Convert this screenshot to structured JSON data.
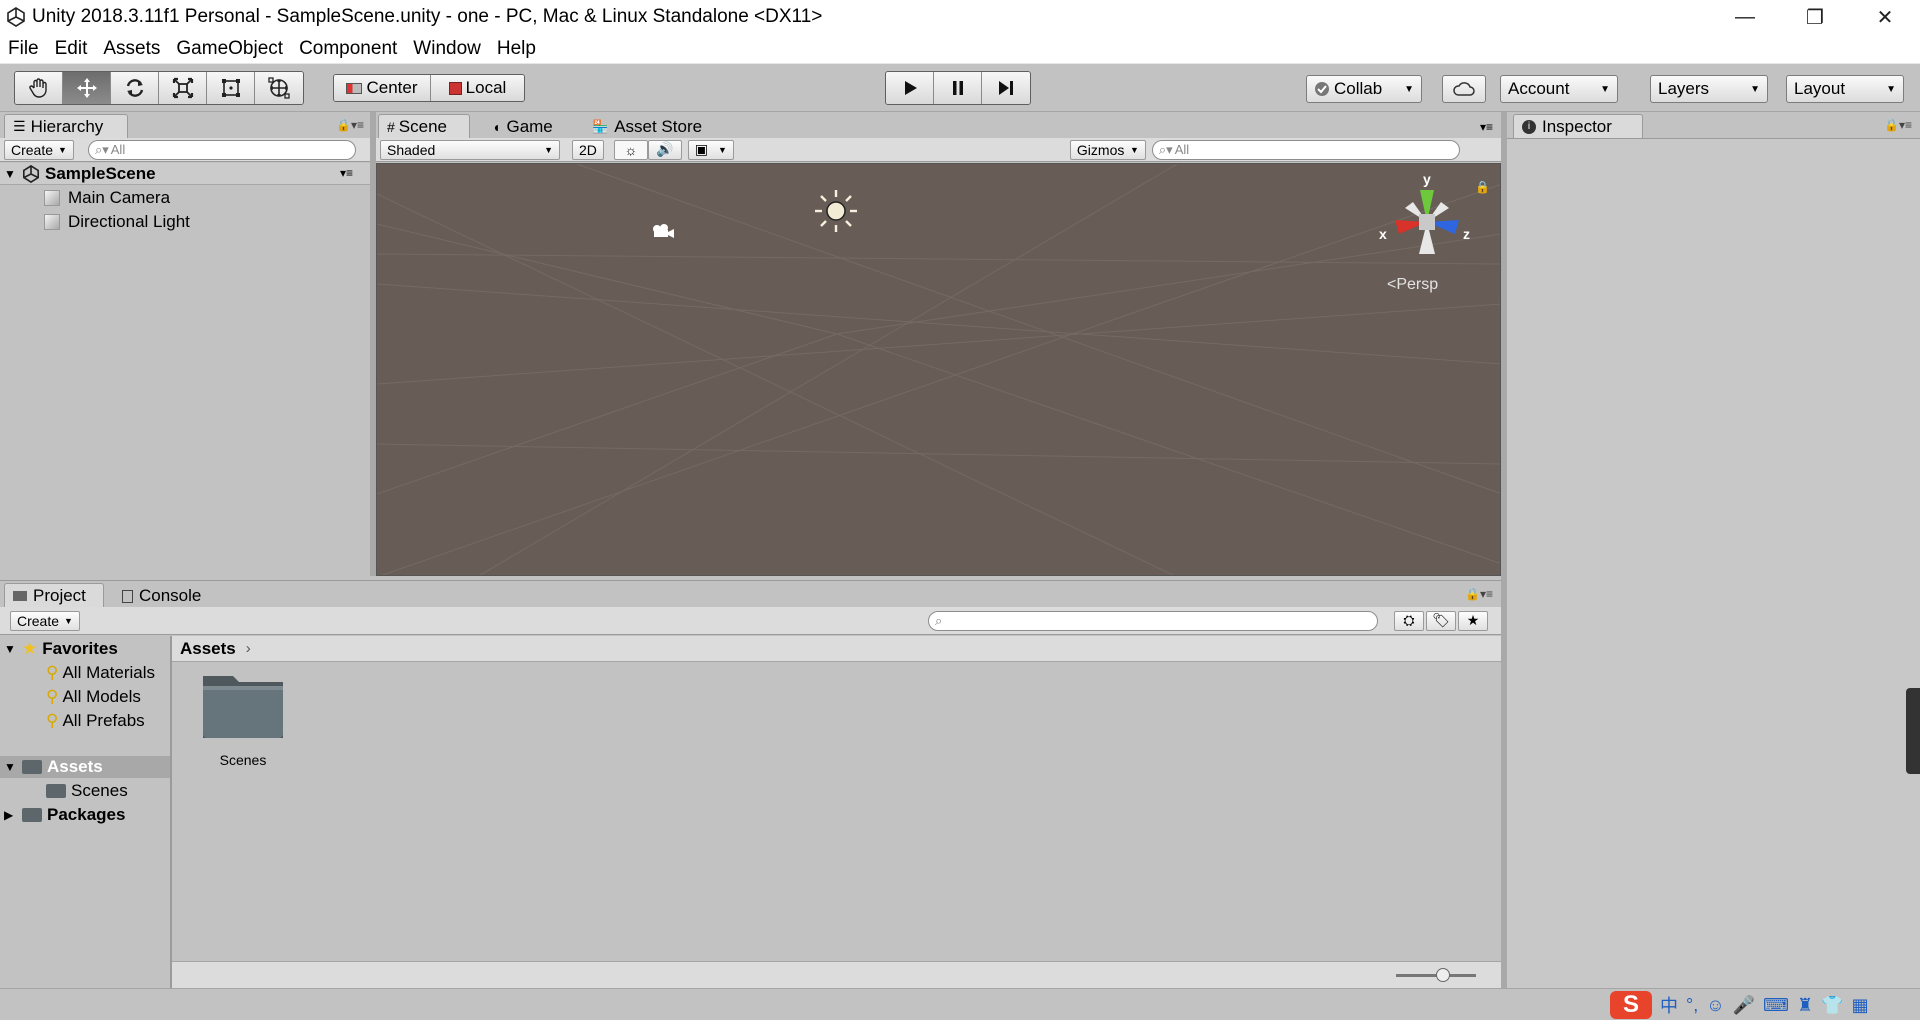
{
  "window": {
    "title": "Unity 2018.3.11f1 Personal - SampleScene.unity - one - PC, Mac & Linux Standalone <DX11>",
    "controls": [
      "—",
      "❐",
      "✕"
    ]
  },
  "menu": [
    "File",
    "Edit",
    "Assets",
    "GameObject",
    "Component",
    "Window",
    "Help"
  ],
  "toolbar": {
    "tools": [
      "hand-tool-icon",
      "move-tool-icon",
      "rotate-tool-icon",
      "scale-tool-icon",
      "rect-tool-icon",
      "transform-tool-icon"
    ],
    "pivot": "Center",
    "space": "Local",
    "collab": "Collab",
    "account": "Account",
    "layers": "Layers",
    "layout": "Layout"
  },
  "hierarchy": {
    "tab": "Hierarchy",
    "create": "Create",
    "search_placeholder": "All",
    "scene": "SampleScene",
    "items": [
      "Main Camera",
      "Directional Light"
    ]
  },
  "scene": {
    "tabs": [
      "Scene",
      "Game",
      "Asset Store"
    ],
    "shading": "Shaded",
    "mode2d": "2D",
    "gizmos": "Gizmos",
    "search_placeholder": "All",
    "axes": {
      "y": "y",
      "x": "x",
      "z": "z"
    },
    "projection": "Persp"
  },
  "inspector": {
    "tab": "Inspector"
  },
  "project": {
    "tabs": [
      "Project",
      "Console"
    ],
    "create": "Create",
    "favorites": "Favorites",
    "favorite_items": [
      "All Materials",
      "All Models",
      "All Prefabs"
    ],
    "assets": "Assets",
    "asset_children": [
      "Scenes"
    ],
    "packages": "Packages",
    "breadcrumb": "Assets",
    "folders": [
      "Scenes"
    ]
  },
  "colors": {
    "scene_bg": "#675d56",
    "panel_bg": "#c2c2c2",
    "axis_y": "#6ec83b",
    "axis_x": "#d8322a",
    "axis_z": "#2f66e0"
  }
}
